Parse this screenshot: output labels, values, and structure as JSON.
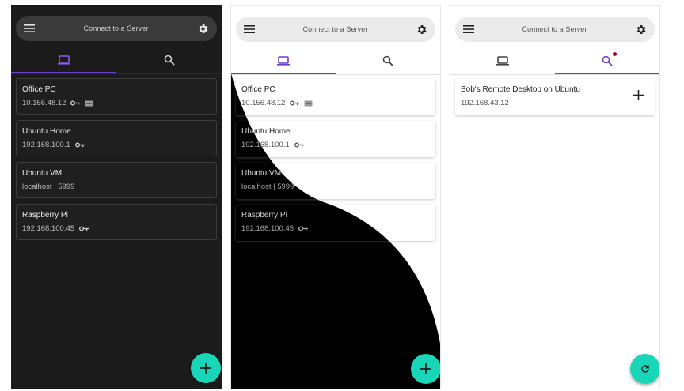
{
  "topbar": {
    "title": "Connect to a Server"
  },
  "tabs": [
    {
      "name": "saved"
    },
    {
      "name": "discover"
    }
  ],
  "saved_servers": [
    {
      "name": "Office PC",
      "address": "10.156.48.12",
      "icons": [
        "key-icon",
        "ssh-icon"
      ]
    },
    {
      "name": "Ubuntu Home",
      "address": "192.168.100.1",
      "icons": [
        "key-icon"
      ]
    },
    {
      "name": "Ubuntu VM",
      "address": "localhost | 5999",
      "icons": []
    },
    {
      "name": "Raspberry Pi",
      "address": "192.168.100.45",
      "icons": [
        "key-icon"
      ]
    }
  ],
  "discovered_servers": [
    {
      "name": "Bob's Remote Desktop on Ubuntu",
      "address": "192.168.43.12"
    }
  ],
  "colors": {
    "accent": "#6d3bd1",
    "fab": "#19d6b8",
    "dark_bg": "#1b1b1b",
    "badge": "#b0002a"
  }
}
